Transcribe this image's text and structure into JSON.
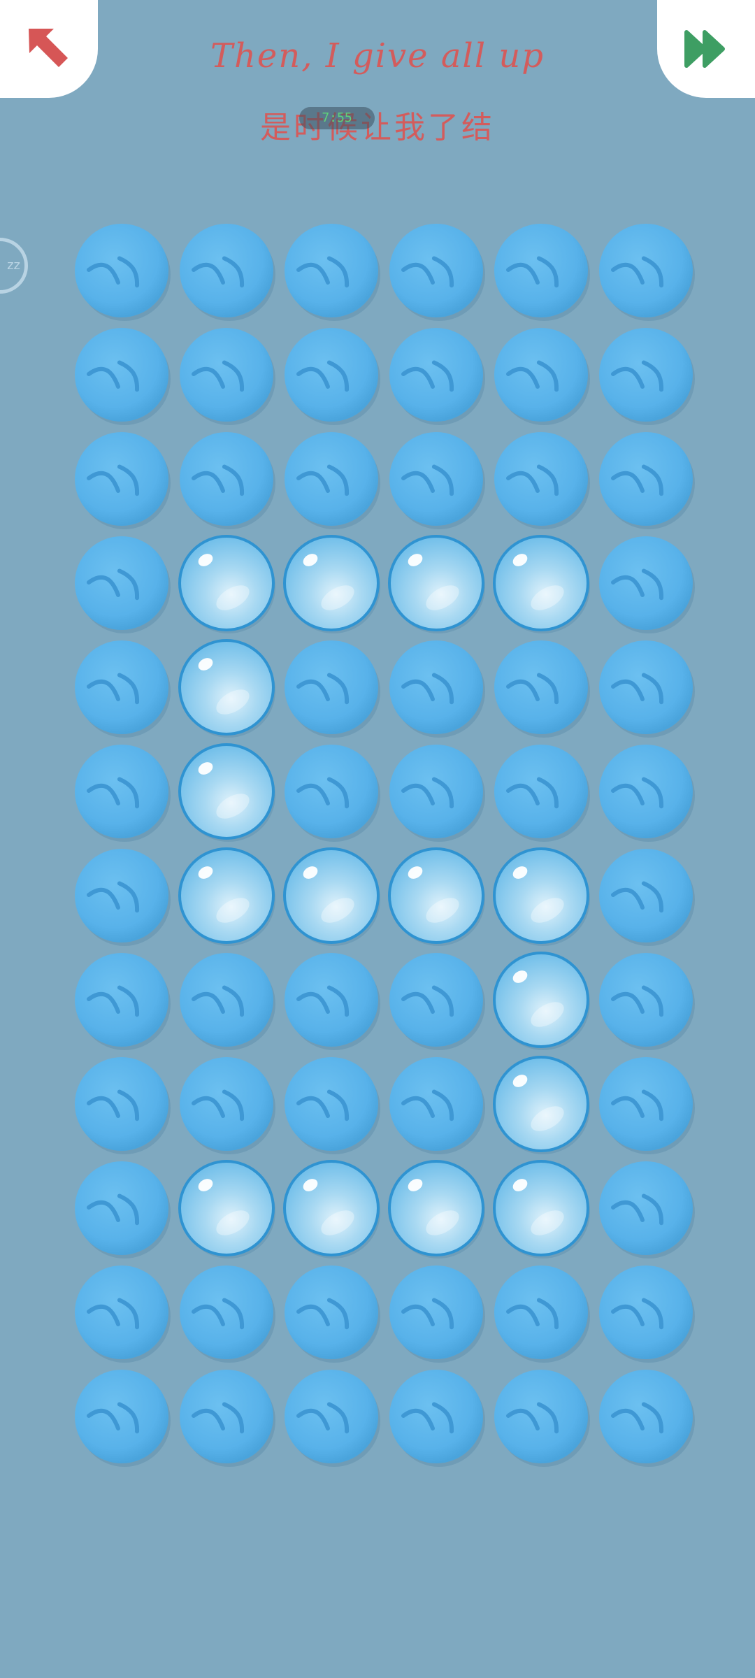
{
  "header": {
    "title_en": "Then, I give all up",
    "title_zh": "是时候让我了结",
    "timer": "7:55"
  },
  "side_badge": {
    "label": "zz"
  },
  "icons": {
    "back": "red-diagonal-arrow-icon",
    "skip": "green-fast-forward-icon"
  },
  "colors": {
    "background": "#7fa9c0",
    "bubble_unpopped": "#5ab4ec",
    "bubble_popped": "#9fd2ef",
    "title": "#d35c5c",
    "back_arrow": "#d65656",
    "skip_arrow": "#3e9e63"
  },
  "grid": {
    "rows": 12,
    "cols": 6,
    "cells": [
      [
        "unpopped",
        "unpopped",
        "unpopped",
        "unpopped",
        "unpopped",
        "unpopped"
      ],
      [
        "unpopped",
        "unpopped",
        "unpopped",
        "unpopped",
        "unpopped",
        "unpopped"
      ],
      [
        "unpopped",
        "unpopped",
        "unpopped",
        "unpopped",
        "unpopped",
        "unpopped"
      ],
      [
        "unpopped",
        "popped",
        "popped",
        "popped",
        "popped",
        "unpopped"
      ],
      [
        "unpopped",
        "popped",
        "unpopped",
        "unpopped",
        "unpopped",
        "unpopped"
      ],
      [
        "unpopped",
        "popped",
        "unpopped",
        "unpopped",
        "unpopped",
        "unpopped"
      ],
      [
        "unpopped",
        "popped",
        "popped",
        "popped",
        "popped",
        "unpopped"
      ],
      [
        "unpopped",
        "unpopped",
        "unpopped",
        "unpopped",
        "popped",
        "unpopped"
      ],
      [
        "unpopped",
        "unpopped",
        "unpopped",
        "unpopped",
        "popped",
        "unpopped"
      ],
      [
        "unpopped",
        "popped",
        "popped",
        "popped",
        "popped",
        "unpopped"
      ],
      [
        "unpopped",
        "unpopped",
        "unpopped",
        "unpopped",
        "unpopped",
        "unpopped"
      ],
      [
        "unpopped",
        "unpopped",
        "unpopped",
        "unpopped",
        "unpopped",
        "unpopped"
      ]
    ]
  }
}
